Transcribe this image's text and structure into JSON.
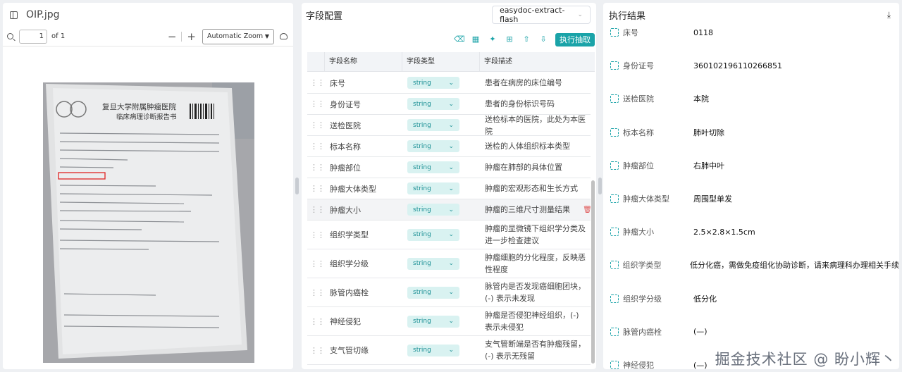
{
  "viewer": {
    "filename": "OIP.jpg",
    "page_current": "1",
    "page_total_label": "of 1",
    "zoom_label": "Automatic Zoom",
    "zoom_out": "−",
    "zoom_in": "+"
  },
  "config": {
    "title": "字段配置",
    "model": "easydoc-extract-flash",
    "run_label": "执行抽取",
    "toolbar_icons": [
      "eraser-icon",
      "grid-icon",
      "magic-icon",
      "add-field-icon",
      "upload-icon",
      "download-icon"
    ],
    "columns": [
      "字段名称",
      "字段类型",
      "字段描述"
    ],
    "rows": [
      {
        "name": "床号",
        "type": "string",
        "desc": "患者在病房的床位编号"
      },
      {
        "name": "身份证号",
        "type": "string",
        "desc": "患者的身份标识号码"
      },
      {
        "name": "送检医院",
        "type": "string",
        "desc": "送检标本的医院，此处为本医院"
      },
      {
        "name": "标本名称",
        "type": "string",
        "desc": "送检的人体组织标本类型"
      },
      {
        "name": "肿瘤部位",
        "type": "string",
        "desc": "肿瘤在肺部的具体位置"
      },
      {
        "name": "肿瘤大体类型",
        "type": "string",
        "desc": "肿瘤的宏观形态和生长方式"
      },
      {
        "name": "肿瘤大小",
        "type": "string",
        "desc": "肿瘤的三维尺寸测量结果"
      },
      {
        "name": "组织学类型",
        "type": "string",
        "desc": "肿瘤的显微镜下组织学分类及进一步检查建议"
      },
      {
        "name": "组织学分级",
        "type": "string",
        "desc": "肿瘤细胞的分化程度，反映恶性程度"
      },
      {
        "name": "脉管内癌栓",
        "type": "string",
        "desc": "脉管内是否发现癌细胞团块，(-) 表示未发现"
      },
      {
        "name": "神经侵犯",
        "type": "string",
        "desc": "肿瘤是否侵犯神经组织，(-) 表示未侵犯"
      },
      {
        "name": "支气管切缘",
        "type": "string",
        "desc": "支气管断端是否有肿瘤残留，(-) 表示无残留"
      }
    ]
  },
  "result": {
    "title": "执行结果",
    "items": [
      {
        "key": "床号",
        "value": "0118"
      },
      {
        "key": "身份证号",
        "value": "360102196110266851"
      },
      {
        "key": "送检医院",
        "value": "本院"
      },
      {
        "key": "标本名称",
        "value": "肺叶切除"
      },
      {
        "key": "肿瘤部位",
        "value": "右肺中叶"
      },
      {
        "key": "肿瘤大体类型",
        "value": "周围型单发"
      },
      {
        "key": "肿瘤大小",
        "value": "2.5×2.8×1.5cm"
      },
      {
        "key": "组织学类型",
        "value": "低分化癌，需做免疫组化协助诊断，请来病理科办理相关手续"
      },
      {
        "key": "组织学分级",
        "value": "低分化"
      },
      {
        "key": "脉管内癌栓",
        "value": "(—)"
      },
      {
        "key": "神经侵犯",
        "value": "(—)"
      }
    ]
  },
  "document": {
    "lines": [
      "复旦大学附属肿瘤医院",
      "临床病理诊断报告书"
    ]
  },
  "watermark": "掘金技术社区 @ 盼小辉丶",
  "colors": {
    "accent": "#1aa3a8",
    "type_bg": "#d9f2f1",
    "delete": "#e05a5a"
  }
}
